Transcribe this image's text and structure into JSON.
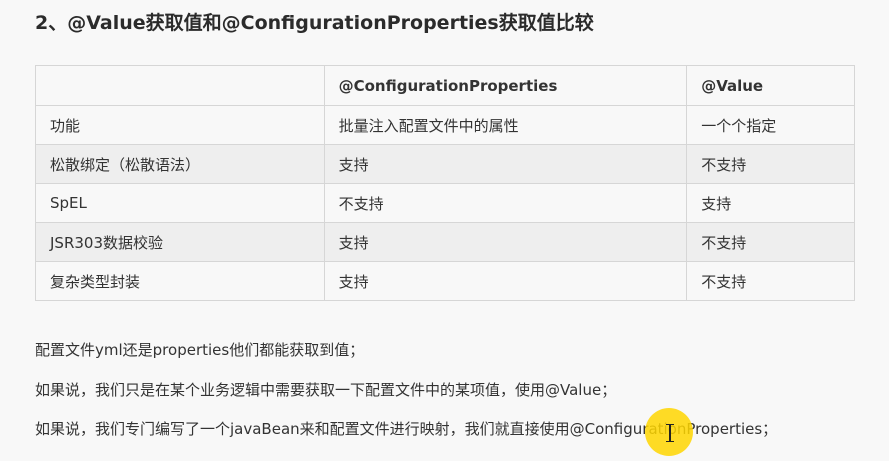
{
  "heading": "2、@Value获取值和@ConfigurationProperties获取值比较",
  "table": {
    "headers": [
      "",
      "@ConfigurationProperties",
      "@Value"
    ],
    "rows": [
      [
        "功能",
        "批量注入配置文件中的属性",
        "一个个指定"
      ],
      [
        "松散绑定（松散语法）",
        "支持",
        "不支持"
      ],
      [
        "SpEL",
        "不支持",
        "支持"
      ],
      [
        "JSR303数据校验",
        "支持",
        "不支持"
      ],
      [
        "复杂类型封装",
        "支持",
        "不支持"
      ]
    ]
  },
  "paragraphs": [
    "配置文件yml还是properties他们都能获取到值；",
    "如果说，我们只是在某个业务逻辑中需要获取一下配置文件中的某项值，使用@Value；",
    "如果说，我们专门编写了一个javaBean来和配置文件进行映射，我们就直接使用@ConfigurationProperties；"
  ],
  "colors": {
    "background": "#f8f8f8",
    "row_alt": "#eeeeee",
    "border": "#d6d6d6",
    "cursor_highlight": "#ffd600"
  }
}
